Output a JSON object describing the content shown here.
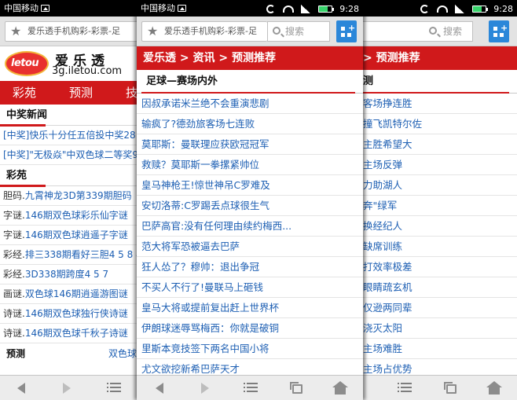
{
  "status": {
    "carrier": "中国移动",
    "time": "9:28"
  },
  "addressbar": {
    "url_title": "爱乐透手机购彩-彩票-足",
    "search_placeholder": "搜索",
    "new_tab_label": "+"
  },
  "left": {
    "logo_text": "letou",
    "site_name": "爱乐透",
    "site_url": "3g.iletou.com",
    "nav": [
      "彩苑",
      "预测",
      "技"
    ],
    "news_header": "中奖新闻",
    "news": [
      "[中奖]快乐十分任五倍投中奖28",
      "[中奖]\"无极焱\"中双色球二等奖9"
    ],
    "caiyuan_header": "彩苑",
    "rows": [
      {
        "prefix": "胆码.",
        "link": "九霄神龙3D第339期胆码"
      },
      {
        "prefix": "字谜.",
        "link": "146期双色球彩乐仙字谜"
      },
      {
        "prefix": "字谜.",
        "link": "146期双色球逍遥子字谜"
      },
      {
        "prefix": "彩经.",
        "link": "排三338期看好三胆4 5 8 4"
      },
      {
        "prefix": "彩经.",
        "link": "3D338期跨度4 5 7"
      },
      {
        "prefix": "画谜.",
        "link": "双色球146期逍遥游图谜"
      },
      {
        "prefix": "诗谜.",
        "link": "146期双色球独行侠诗谜"
      },
      {
        "prefix": "诗谜.",
        "link": "146期双色球千秋子诗谜"
      }
    ],
    "footer_left": "预测",
    "footer_right": "双色球"
  },
  "middle": {
    "breadcrumb": "爱乐透 > 资讯 > 预测推荐",
    "section": "足球—赛场内外",
    "articles": [
      "因叔承诺米兰绝不会重演悲剧",
      "输疯了?德劲旅客场七连败",
      "莫耶斯：曼联理应获欧冠冠军",
      "救赎？莫耶斯一拳摞紧帅位",
      "皇马神枪王!惊世神吊C罗难及",
      "安切洛蒂:C罗踢丢点球很生气",
      "巴萨高官:没有任何理由续约梅西...",
      "范大将军恐被逼去巴萨",
      "狂人怂了？穆帅：退出争冠",
      "不买人不行了!曼联马上砸钱",
      "皇马大将或提前复出赶上世界杯",
      "伊朗球迷辱骂梅西：你就是破铜",
      "里斯本竞技签下两名中国小将",
      "尤文欲挖新希巴萨天才"
    ]
  },
  "right": {
    "breadcrumb": "> 预测推荐",
    "section": "测",
    "articles": [
      "客场挣连胜",
      "撞飞凯特尔佐",
      "主胜希望大",
      "主场反弹",
      "力助湖人",
      "奔\"绿军",
      "换经纪人",
      "缺席训练",
      "打效率极差",
      "眼睛疏玄机",
      "仅逊两同辈",
      "浇灭太阳",
      "主场难胜",
      "主场占优势"
    ]
  }
}
